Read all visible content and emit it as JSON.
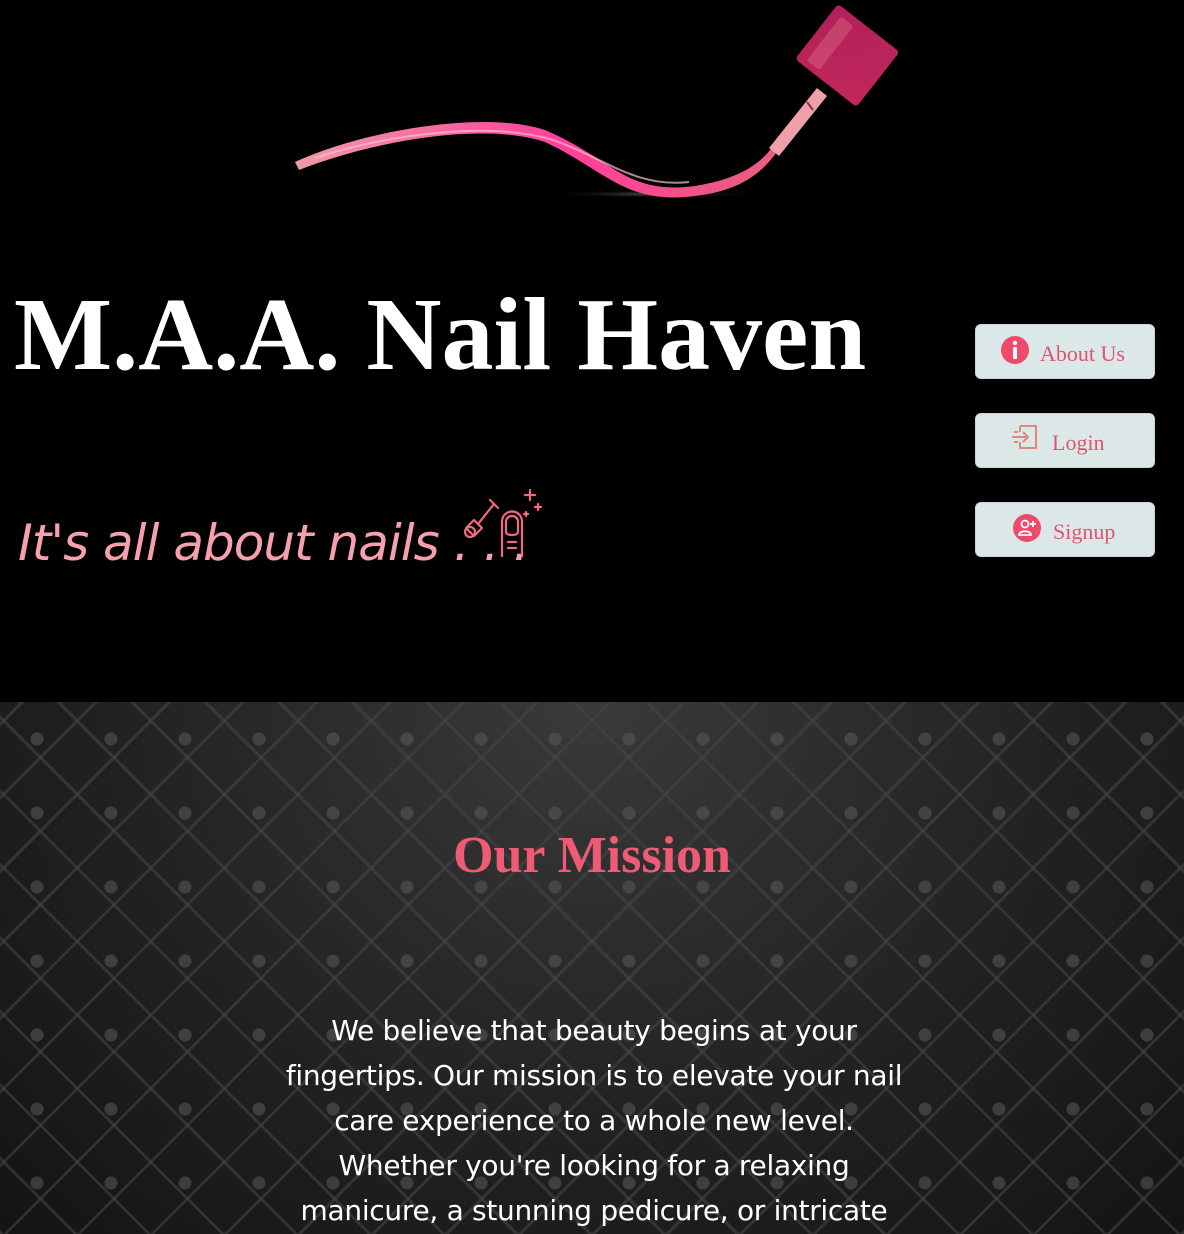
{
  "header": {
    "site_title": "M.A.A. Nail Haven",
    "tagline": "It's all about nails . . .",
    "logo_icon": "nail-polish-brush-stroke",
    "tagline_icon": "nail-polish-icon"
  },
  "nav": {
    "buttons": [
      {
        "label": "About Us",
        "icon": "info-icon"
      },
      {
        "label": "Login",
        "icon": "login-icon"
      },
      {
        "label": "Signup",
        "icon": "add-user-icon"
      }
    ]
  },
  "mission": {
    "title": "Our Mission",
    "body": "We believe that beauty begins at your fingertips. Our mission is to elevate your nail care experience to a whole new level. Whether you're looking for a relaxing manicure, a stunning pedicure, or intricate"
  },
  "colors": {
    "background": "#000000",
    "accent_pink": "#ef5b75",
    "tagline_pink": "#f7a0ad",
    "button_bg": "#dce8e8"
  }
}
